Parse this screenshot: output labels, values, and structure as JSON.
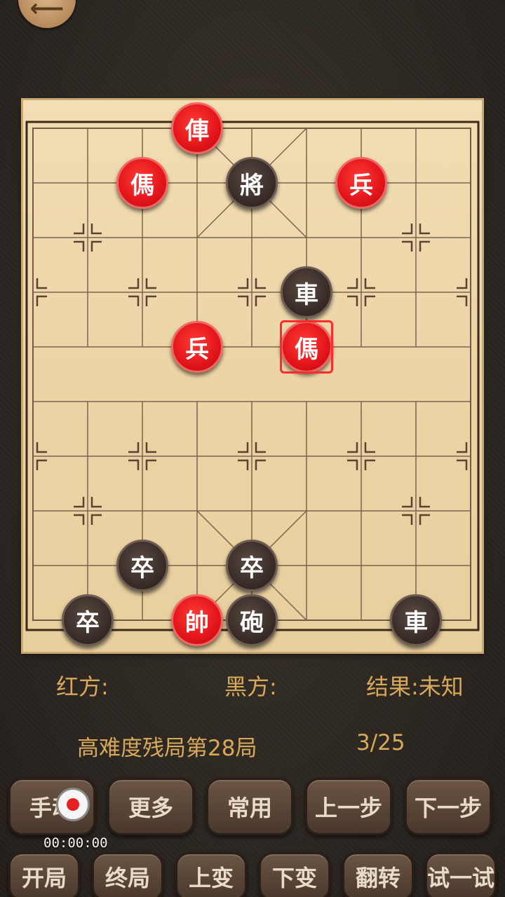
{
  "info": {
    "red_label": "红方:",
    "black_label": "黑方:",
    "result_label": "结果:未知"
  },
  "level": {
    "title": "高难度残局第28局",
    "progress": "3/25"
  },
  "record": {
    "time": "00:00:00"
  },
  "buttons_row1": [
    "手动",
    "更多",
    "常用",
    "上一步",
    "下一步"
  ],
  "buttons_row2": [
    "开局",
    "终局",
    "上变",
    "下变",
    "翻转",
    "试一试"
  ],
  "pieces": [
    {
      "char": "俥",
      "side": "red",
      "col": 3,
      "row": 0
    },
    {
      "char": "傌",
      "side": "red",
      "col": 2,
      "row": 1
    },
    {
      "char": "將",
      "side": "black",
      "col": 4,
      "row": 1
    },
    {
      "char": "兵",
      "side": "red",
      "col": 6,
      "row": 1
    },
    {
      "char": "車",
      "side": "black",
      "col": 5,
      "row": 3
    },
    {
      "char": "兵",
      "side": "red",
      "col": 3,
      "row": 4
    },
    {
      "char": "傌",
      "side": "red",
      "col": 5,
      "row": 4,
      "selected": true
    },
    {
      "char": "卒",
      "side": "black",
      "col": 2,
      "row": 8
    },
    {
      "char": "卒",
      "side": "black",
      "col": 4,
      "row": 8
    },
    {
      "char": "卒",
      "side": "black",
      "col": 1,
      "row": 9
    },
    {
      "char": "帥",
      "side": "red",
      "col": 3,
      "row": 9
    },
    {
      "char": "砲",
      "side": "black",
      "col": 4,
      "row": 9
    },
    {
      "char": "車",
      "side": "black",
      "col": 7,
      "row": 9
    }
  ]
}
